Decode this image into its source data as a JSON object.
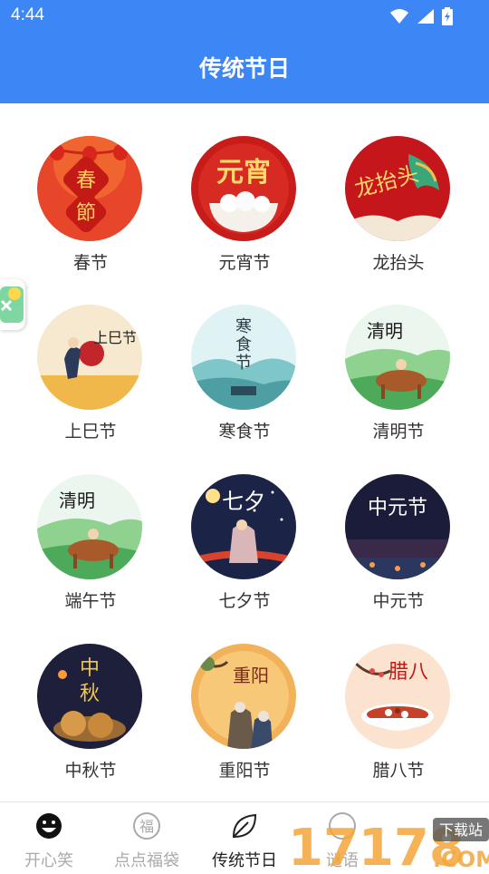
{
  "status": {
    "time": "4:44"
  },
  "header": {
    "title": "传统节日"
  },
  "festivals": [
    {
      "label": "春节",
      "icon": "spring-festival-image"
    },
    {
      "label": "元宵节",
      "icon": "lantern-festival-image"
    },
    {
      "label": "龙抬头",
      "icon": "dragon-head-image"
    },
    {
      "label": "上巳节",
      "icon": "shangsi-festival-image"
    },
    {
      "label": "寒食节",
      "icon": "cold-food-festival-image"
    },
    {
      "label": "清明节",
      "icon": "qingming-festival-image"
    },
    {
      "label": "端午节",
      "icon": "dragon-boat-festival-image"
    },
    {
      "label": "七夕节",
      "icon": "qixi-festival-image"
    },
    {
      "label": "中元节",
      "icon": "zhongyuan-festival-image"
    },
    {
      "label": "中秋节",
      "icon": "mid-autumn-festival-image"
    },
    {
      "label": "重阳节",
      "icon": "double-ninth-festival-image"
    },
    {
      "label": "腊八节",
      "icon": "laba-festival-image"
    }
  ],
  "image_text": {
    "chunjie": [
      "春",
      "節"
    ],
    "yuanxiao": "元宵",
    "longtaitou": "龙抬头",
    "shangsi": "上巳节",
    "hanshi": [
      "寒",
      "食",
      "节"
    ],
    "qingming": "清明",
    "qixi": "七夕",
    "zhongyuan": "中元节",
    "zhongqiu": [
      "中",
      "秋"
    ],
    "chongyang": "重阳",
    "laba": "腊八"
  },
  "nav": {
    "items": [
      {
        "label": "开心笑",
        "icon": "smiley-icon"
      },
      {
        "label": "点点福袋",
        "icon": "fu-icon",
        "icon_char": "福"
      },
      {
        "label": "传统节日",
        "icon": "leaf-icon"
      },
      {
        "label": "谜语",
        "icon": "riddle-icon"
      }
    ]
  },
  "watermark": {
    "text": "17178",
    "sub": "下载站",
    "domain": ".COM"
  },
  "colors": {
    "primary": "#3d86f5",
    "active": "#222222",
    "inactive": "#aaaaaa"
  }
}
